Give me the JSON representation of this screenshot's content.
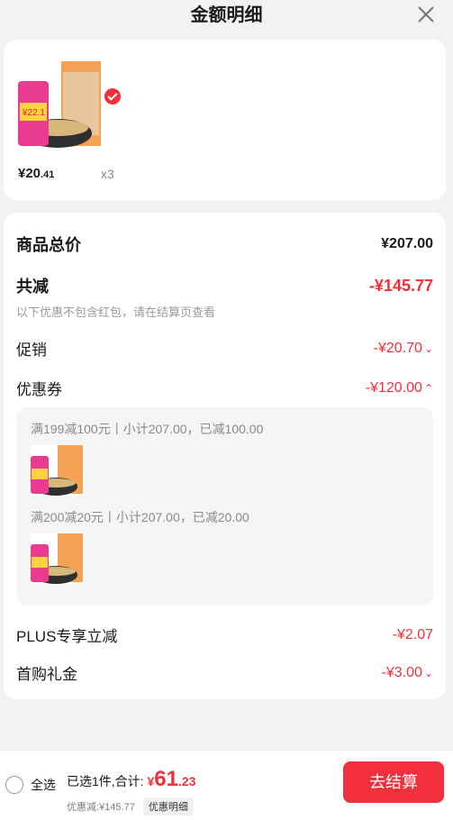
{
  "header": {
    "title": "金额明细"
  },
  "product": {
    "price_int": "¥20",
    "price_dec": ".41",
    "qty": "x3"
  },
  "summary": {
    "total_label": "商品总价",
    "total_value": "¥207.00",
    "reduce_label": "共减",
    "reduce_value": "-¥145.77",
    "note": "以下优惠不包含红包，请在结算页查看",
    "promo_label": "促销",
    "promo_value": "-¥20.70",
    "coupon_label": "优惠券",
    "coupon_value": "-¥120.00",
    "coupon_lines": [
      "满199减100元丨小计207.00，已减100.00",
      "满200减20元丨小计207.00，已减20.00"
    ],
    "plus_label": "PLUS专享立减",
    "plus_value": "-¥2.07",
    "first_label": "首购礼金",
    "first_value": "-¥3.00"
  },
  "bottom": {
    "select_all": "全选",
    "selected_prefix": "已选1件,合计:",
    "total_yen": "¥",
    "total_int": "61",
    "total_dec": ".23",
    "discount": "优惠减:¥145.77",
    "detail": "优惠明细",
    "checkout": "去结算"
  },
  "colors": {
    "accent": "#f2303b"
  },
  "icons": {
    "close": "close-icon",
    "check": "check-icon",
    "chevron_down": "chevron-down-icon",
    "chevron_up": "chevron-up-icon"
  }
}
